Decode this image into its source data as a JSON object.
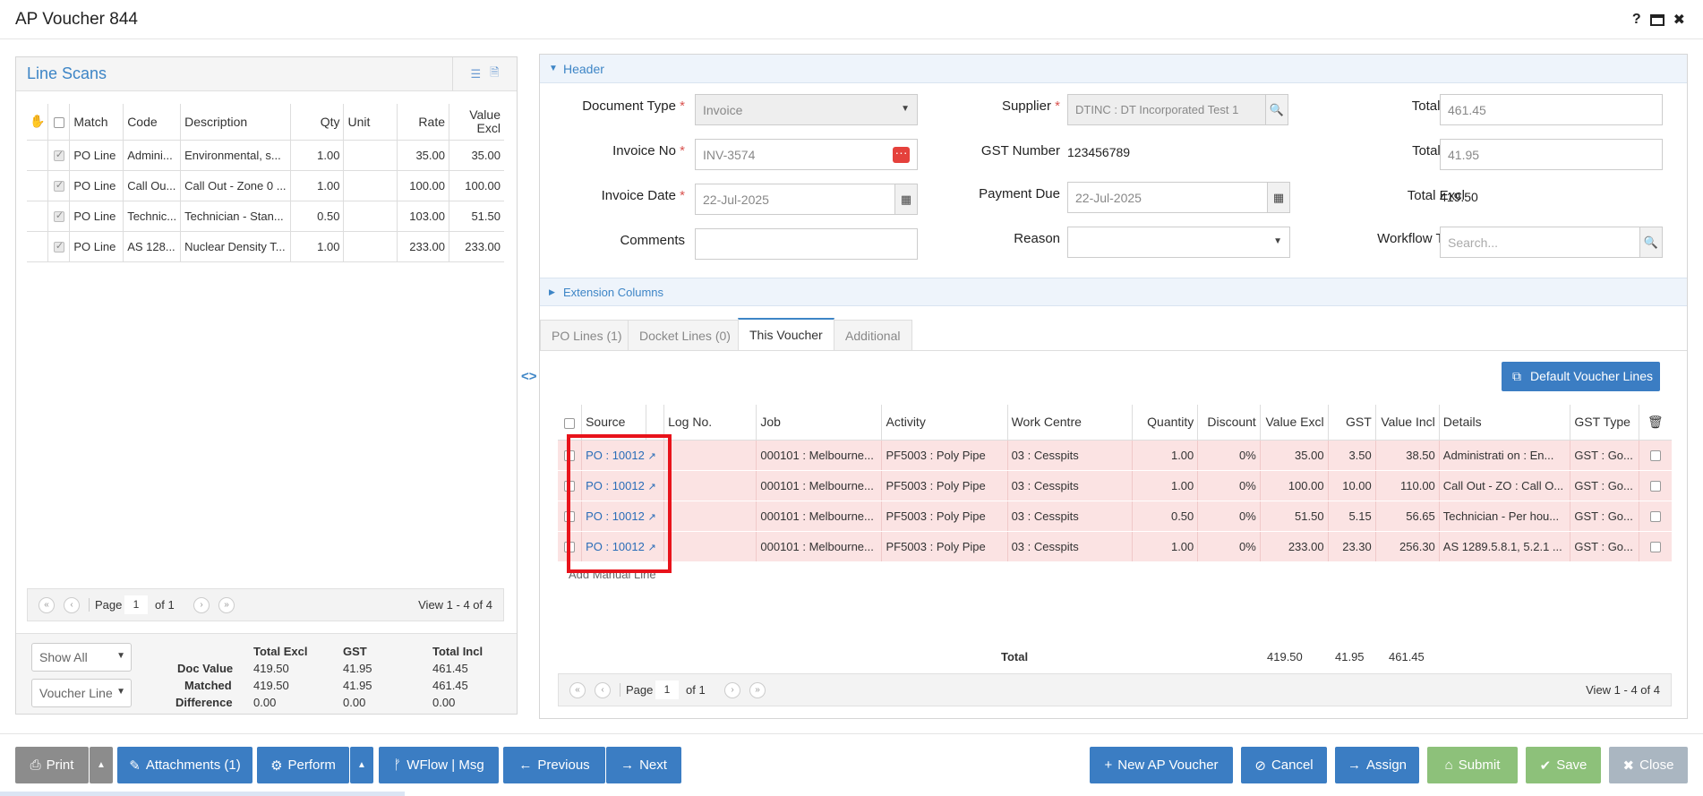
{
  "window": {
    "title": "AP Voucher 844"
  },
  "line_scans": {
    "title": "Line Scans",
    "columns": [
      "Match",
      "Code",
      "Description",
      "Qty",
      "Unit",
      "Rate",
      "Value Excl"
    ],
    "rows": [
      {
        "match": "PO Line",
        "code": "Admini...",
        "desc": "Environmental, s...",
        "qty": "1.00",
        "unit": "",
        "rate": "35.00",
        "value": "35.00"
      },
      {
        "match": "PO Line",
        "code": "Call Ou...",
        "desc": "Call Out - Zone 0 ...",
        "qty": "1.00",
        "unit": "",
        "rate": "100.00",
        "value": "100.00"
      },
      {
        "match": "PO Line",
        "code": "Technic...",
        "desc": "Technician - Stan...",
        "qty": "0.50",
        "unit": "",
        "rate": "103.00",
        "value": "51.50"
      },
      {
        "match": "PO Line",
        "code": "AS 128...",
        "desc": "Nuclear Density T...",
        "qty": "1.00",
        "unit": "",
        "rate": "233.00",
        "value": "233.00"
      }
    ],
    "pager": {
      "page_label": "Page",
      "page": "1",
      "of": "of 1",
      "view": "View 1 - 4 of 4"
    },
    "filter_show": "Show All",
    "filter_voucher": "Voucher Line",
    "totals": {
      "headers": [
        "Total Excl",
        "GST",
        "Total Incl"
      ],
      "rows": [
        {
          "label": "Doc Value",
          "excl": "419.50",
          "gst": "41.95",
          "incl": "461.45"
        },
        {
          "label": "Matched",
          "excl": "419.50",
          "gst": "41.95",
          "incl": "461.45"
        },
        {
          "label": "Difference",
          "excl": "0.00",
          "gst": "0.00",
          "incl": "0.00"
        }
      ]
    }
  },
  "header": {
    "section_label": "Header",
    "document_type": {
      "label": "Document Type",
      "value": "Invoice"
    },
    "invoice_no": {
      "label": "Invoice No",
      "value": "INV-3574"
    },
    "invoice_date": {
      "label": "Invoice Date",
      "value": "22-Jul-2025"
    },
    "comments": {
      "label": "Comments",
      "value": ""
    },
    "supplier": {
      "label": "Supplier",
      "value": "DTINC : DT Incorporated Test 1"
    },
    "gst_number": {
      "label": "GST Number",
      "value": "123456789"
    },
    "payment_due": {
      "label": "Payment Due",
      "value": "22-Jul-2025"
    },
    "reason": {
      "label": "Reason",
      "value": ""
    },
    "total_incl": {
      "label": "Total Incl",
      "value": "461.45"
    },
    "total_tax": {
      "label": "Total Tax",
      "value": "41.95"
    },
    "total_excl": {
      "label": "Total Excl",
      "value": "419.50"
    },
    "workflow_type": {
      "label": "Workflow Type",
      "placeholder": "Search..."
    }
  },
  "extension_columns_label": "Extension Columns",
  "tabs": [
    "PO Lines (1)",
    "Docket Lines (0)",
    "This Voucher",
    "Additional"
  ],
  "default_voucher_lines_label": "Default Voucher Lines",
  "voucher_grid": {
    "columns": [
      "Source",
      "Log No.",
      "Job",
      "Activity",
      "Work Centre",
      "Quantity",
      "Discount",
      "Value Excl",
      "GST",
      "Value Incl",
      "Details",
      "GST Type"
    ],
    "rows": [
      {
        "source": "PO : 10012",
        "log": "",
        "job": "000101 : Melbourne...",
        "activity": "PF5003 : Poly Pipe",
        "wc": "03 : Cesspits",
        "qty": "1.00",
        "disc": "0%",
        "excl": "35.00",
        "gst": "3.50",
        "incl": "38.50",
        "details": "Administrati on : En...",
        "gsttype": "GST : Go..."
      },
      {
        "source": "PO : 10012",
        "log": "",
        "job": "000101 : Melbourne...",
        "activity": "PF5003 : Poly Pipe",
        "wc": "03 : Cesspits",
        "qty": "1.00",
        "disc": "0%",
        "excl": "100.00",
        "gst": "10.00",
        "incl": "110.00",
        "details": "Call Out - ZO : Call O...",
        "gsttype": "GST : Go..."
      },
      {
        "source": "PO : 10012",
        "log": "",
        "job": "000101 : Melbourne...",
        "activity": "PF5003 : Poly Pipe",
        "wc": "03 : Cesspits",
        "qty": "0.50",
        "disc": "0%",
        "excl": "51.50",
        "gst": "5.15",
        "incl": "56.65",
        "details": "Technician - Per hou...",
        "gsttype": "GST : Go..."
      },
      {
        "source": "PO : 10012",
        "log": "",
        "job": "000101 : Melbourne...",
        "activity": "PF5003 : Poly Pipe",
        "wc": "03 : Cesspits",
        "qty": "1.00",
        "disc": "0%",
        "excl": "233.00",
        "gst": "23.30",
        "incl": "256.30",
        "details": "AS 1289.5.8.1, 5.2.1 ...",
        "gsttype": "GST : Go..."
      }
    ],
    "add_manual_line": "Add Manual Line",
    "total": {
      "label": "Total",
      "excl": "419.50",
      "gst": "41.95",
      "incl": "461.45"
    },
    "pager": {
      "page_label": "Page",
      "page": "1",
      "of": "of 1",
      "view": "View 1 - 4 of 4"
    }
  },
  "footer": {
    "print": "Print",
    "attachments": "Attachments (1)",
    "perform": "Perform",
    "wflow": "WFlow | Msg",
    "previous": "Previous",
    "next": "Next",
    "new_ap_voucher": "New AP Voucher",
    "cancel": "Cancel",
    "assign": "Assign",
    "submit": "Submit",
    "save": "Save",
    "close": "Close"
  },
  "colors": {
    "accent": "#3b7dc3",
    "highlight": "#e8131b",
    "row_error": "#fbe3e3",
    "save_green": "#8dc17a"
  }
}
